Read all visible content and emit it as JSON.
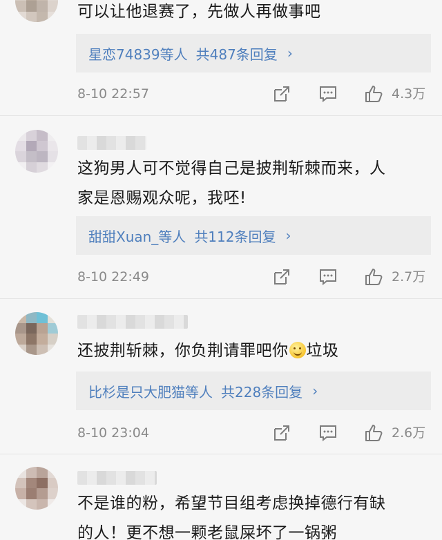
{
  "comments": [
    {
      "text_lines": [
        "可以让他退赛了，先做人再做事吧"
      ],
      "reply_users": "星恋74839等人",
      "reply_count": "共487条回复",
      "time": "8-10 22:57",
      "likes": "4.3万"
    },
    {
      "text_lines": [
        "这狗男人可不觉得自己是披荆斩棘而来，人",
        "家是恩赐观众呢，我呸!"
      ],
      "reply_users": "甜甜Xuan_等人",
      "reply_count": "共112条回复",
      "time": "8-10 22:49",
      "likes": "2.7万"
    },
    {
      "text_before_emoji": "还披荆斩棘，你负荆请罪吧你",
      "text_after_emoji": "垃圾",
      "reply_users": "比杉是只大肥猫等人",
      "reply_count": "共228条回复",
      "time": "8-10 23:04",
      "likes": "2.6万"
    },
    {
      "text_lines": [
        "不是谁的粉，希望节目组考虑换掉德行有缺",
        "的人！更不想一颗老鼠屎坏了一锅粥"
      ]
    }
  ],
  "icons": {
    "chevron": "›",
    "repost": "repost-icon",
    "comment": "comment-icon",
    "like": "like-icon"
  },
  "colors": {
    "link": "#4f7fbd",
    "meta": "#8a8a8a",
    "reply_bg": "#ececec",
    "page_bg": "#f6f6f6"
  }
}
